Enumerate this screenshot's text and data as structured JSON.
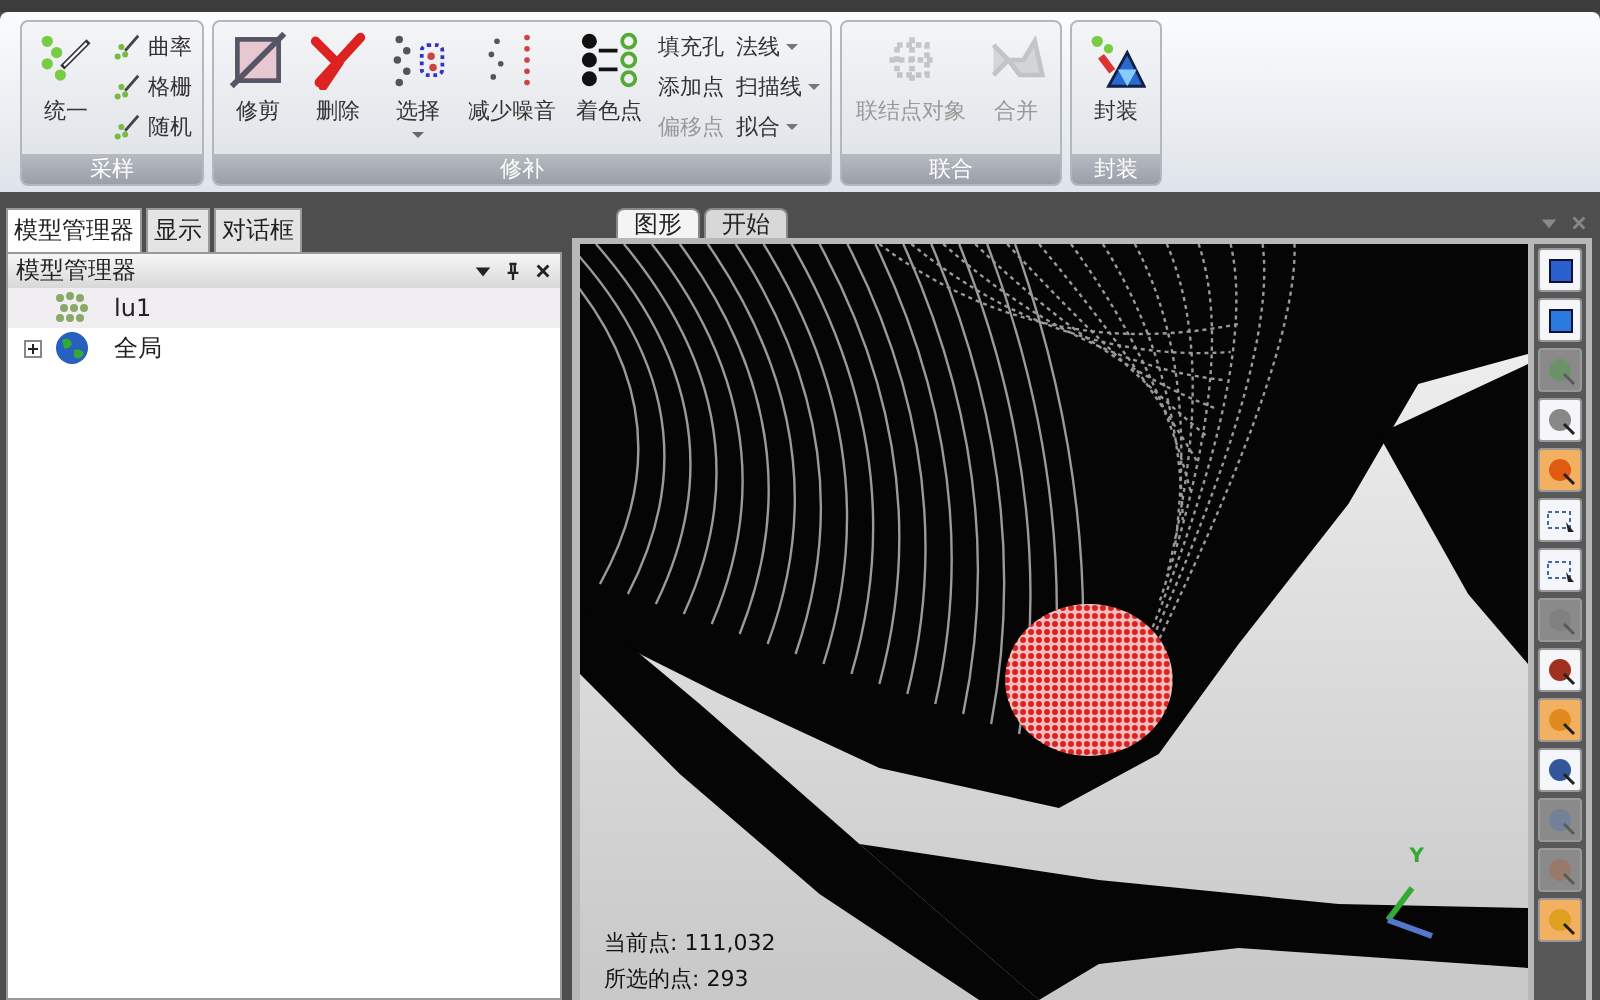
{
  "ribbon": {
    "groups": [
      {
        "label": "采样",
        "columns": [
          {
            "kind": "large",
            "label": "统一",
            "disabled": false,
            "dropdown": false
          },
          {
            "kind": "stack",
            "items": [
              {
                "kind": "icon-text",
                "label": "曲率",
                "disabled": false,
                "dropdown": false
              },
              {
                "kind": "icon-text",
                "label": "格栅",
                "disabled": false,
                "dropdown": false
              },
              {
                "kind": "icon-text",
                "label": "随机",
                "disabled": false,
                "dropdown": false
              }
            ]
          }
        ]
      },
      {
        "label": "修补",
        "columns": [
          {
            "kind": "large",
            "label": "修剪",
            "disabled": false,
            "dropdown": false
          },
          {
            "kind": "large",
            "label": "删除",
            "disabled": false,
            "dropdown": false
          },
          {
            "kind": "large",
            "label": "选择",
            "disabled": false,
            "dropdown": true
          },
          {
            "kind": "large",
            "label": "减少噪音",
            "disabled": false,
            "dropdown": false
          },
          {
            "kind": "large",
            "label": "着色点",
            "disabled": false,
            "dropdown": false
          },
          {
            "kind": "stack",
            "items": [
              {
                "kind": "text",
                "label": "填充孔",
                "disabled": false,
                "dropdown": false
              },
              {
                "kind": "text",
                "label": "添加点",
                "disabled": false,
                "dropdown": false
              },
              {
                "kind": "text",
                "label": "偏移点",
                "disabled": true,
                "dropdown": false
              }
            ]
          },
          {
            "kind": "stack",
            "items": [
              {
                "kind": "text",
                "label": "法线",
                "disabled": false,
                "dropdown": true
              },
              {
                "kind": "text",
                "label": "扫描线",
                "disabled": false,
                "dropdown": true
              },
              {
                "kind": "text",
                "label": "拟合",
                "disabled": false,
                "dropdown": true
              }
            ]
          }
        ]
      },
      {
        "label": "联合",
        "columns": [
          {
            "kind": "large",
            "label": "联结点对象",
            "disabled": true,
            "dropdown": false
          },
          {
            "kind": "large",
            "label": "合并",
            "disabled": true,
            "dropdown": false
          }
        ]
      },
      {
        "label": "封装",
        "columns": [
          {
            "kind": "large",
            "label": "封装",
            "disabled": false,
            "dropdown": false
          }
        ]
      }
    ]
  },
  "left_panel": {
    "tabs": [
      {
        "label": "模型管理器",
        "selected": true
      },
      {
        "label": "显示",
        "selected": false
      },
      {
        "label": "对话框",
        "selected": false
      }
    ],
    "title": "模型管理器",
    "tree": [
      {
        "label": "lu1",
        "kind": "points",
        "selected": true
      },
      {
        "label": "全局",
        "kind": "globe",
        "selected": false,
        "expanded": false
      }
    ]
  },
  "viewport": {
    "tabs": [
      {
        "label": "图形",
        "selected": true
      },
      {
        "label": "开始",
        "selected": false
      }
    ],
    "axis_label": "Y",
    "status_lines": [
      "当前点: 111,032",
      "所选的点: 293"
    ],
    "toolbar": [
      {
        "disabled": false
      },
      {
        "disabled": false
      },
      {
        "disabled": true
      },
      {
        "disabled": false
      },
      {
        "disabled": false
      },
      {
        "disabled": false
      },
      {
        "disabled": false
      },
      {
        "disabled": true
      },
      {
        "disabled": false
      },
      {
        "disabled": false
      },
      {
        "disabled": false
      },
      {
        "disabled": true
      },
      {
        "disabled": true
      },
      {
        "disabled": false
      }
    ]
  }
}
